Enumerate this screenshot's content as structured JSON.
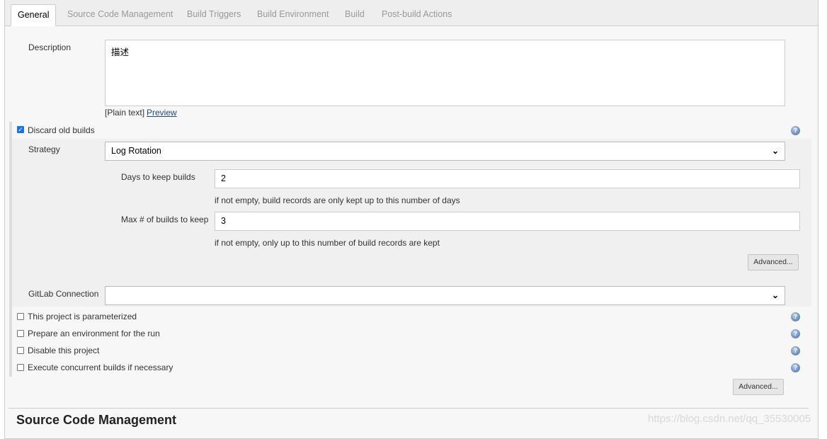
{
  "tabs": [
    "General",
    "Source Code Management",
    "Build Triggers",
    "Build Environment",
    "Build",
    "Post-build Actions"
  ],
  "description": {
    "label": "Description",
    "value": "描述",
    "plain_text": "[Plain text]",
    "preview": "Preview"
  },
  "discard": {
    "label": "Discard old builds",
    "checked": true,
    "strategy_label": "Strategy",
    "strategy_value": "Log Rotation",
    "days_label": "Days to keep builds",
    "days_value": "2",
    "days_help": "if not empty, build records are only kept up to this number of days",
    "max_label": "Max # of builds to keep",
    "max_value": "3",
    "max_help": "if not empty, only up to this number of build records are kept",
    "advanced": "Advanced..."
  },
  "gitlab": {
    "label": "GitLab Connection",
    "value": ""
  },
  "options": [
    {
      "label": "This project is parameterized",
      "checked": false
    },
    {
      "label": "Prepare an environment for the run",
      "checked": false
    },
    {
      "label": "Disable this project",
      "checked": false
    },
    {
      "label": "Execute concurrent builds if necessary",
      "checked": false
    }
  ],
  "advanced2": "Advanced...",
  "section_heading": "Source Code Management",
  "watermark": "https://blog.csdn.net/qq_35530005"
}
